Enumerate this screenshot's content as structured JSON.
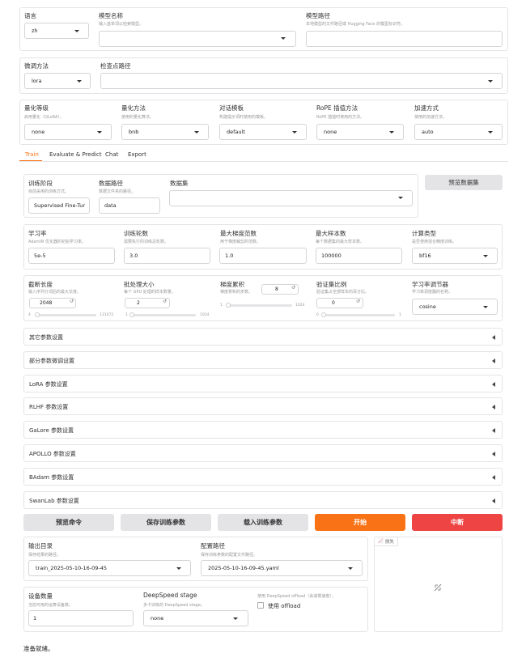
{
  "row1": {
    "lang": {
      "label": "语言",
      "value": "zh"
    },
    "model_name": {
      "label": "模型名称",
      "hint": "输入首单词以检索模型。",
      "value": ""
    },
    "model_path": {
      "label": "模型路径",
      "hint": "本地模型的文件路径或 Hugging Face 的模型标识符。",
      "value": ""
    }
  },
  "row2": {
    "finetune": {
      "label": "微调方法",
      "value": "lora"
    },
    "checkpoint": {
      "label": "检查点路径",
      "value": ""
    }
  },
  "row3": {
    "quant_bit": {
      "label": "量化等级",
      "hint": "启用量化（QLoRA）。",
      "value": "none"
    },
    "quant_method": {
      "label": "量化方法",
      "hint": "使用的量化算法。",
      "value": "bnb"
    },
    "template": {
      "label": "对话模板",
      "hint": "构建提示词时使用的模板。",
      "value": "default"
    },
    "rope": {
      "label": "RoPE 插值方法",
      "hint": "RoPE 插值时使用的方法。",
      "value": "none"
    },
    "booster": {
      "label": "加速方式",
      "hint": "使用的加速方法。",
      "value": "auto"
    }
  },
  "tabs": [
    "Train",
    "Evaluate & Predict",
    "Chat",
    "Export"
  ],
  "stage_row": {
    "stage": {
      "label": "训练阶段",
      "hint": "目前采用的训练方式。",
      "value": "Supervised Fine-Tur"
    },
    "dataset_dir": {
      "label": "数据路径",
      "hint": "数据文件夹的路径。",
      "value": "data"
    },
    "dataset": {
      "label": "数据集",
      "value": ""
    },
    "preview_button": "预览数据集"
  },
  "params1": {
    "lr": {
      "label": "学习率",
      "hint": "AdamW 优化器的初始学习率。",
      "value": "5e-5"
    },
    "epochs": {
      "label": "训练轮数",
      "hint": "需要执行的训练总轮数。",
      "value": "3.0"
    },
    "grad_norm": {
      "label": "最大梯度范数",
      "hint": "用于梯度裁剪的范数。",
      "value": "1.0"
    },
    "max_samples": {
      "label": "最大样本数",
      "hint": "每个数据集的最大样本数。",
      "value": "100000"
    },
    "compute": {
      "label": "计算类型",
      "hint": "是否使用混合精度训练。",
      "value": "bf16"
    }
  },
  "params2": {
    "cutoff": {
      "label": "截断长度",
      "hint": "输入序列分词后的最大长度。",
      "value": "2048",
      "min": "4",
      "max": "131072",
      "level": 0.016
    },
    "batch": {
      "label": "批处理大小",
      "hint": "每个 GPU 处理的样本数量。",
      "value": "2",
      "min": "1",
      "max": "1024",
      "level": 0.001
    },
    "grad_accum": {
      "label": "梯度累积",
      "hint": "梯度累积的步数。",
      "value": "8",
      "min": "1",
      "max": "1024",
      "level": 0.007
    },
    "val_size": {
      "label": "验证集比例",
      "hint": "验证集占全部样本的百分比。",
      "value": "0",
      "min": "0",
      "max": "1",
      "level": 0.0
    },
    "scheduler": {
      "label": "学习率调节器",
      "hint": "学习率调度器的名称。",
      "value": "cosine"
    }
  },
  "accordions": [
    "其它参数设置",
    "部分参数微调设置",
    "LoRA 参数设置",
    "RLHF 参数设置",
    "GaLore 参数设置",
    "APOLLO 参数设置",
    "BAdam 参数设置",
    "SwanLab 参数设置"
  ],
  "actions": {
    "preview_cmd": "预览命令",
    "save_args": "保存训练参数",
    "load_args": "载入训练参数",
    "start": "开始",
    "abort": "中断"
  },
  "output": {
    "output_dir": {
      "label": "输出目录",
      "hint": "保存结果的路径。",
      "value": "train_2025-05-10-16-09-45"
    },
    "config_path": {
      "label": "配置路径",
      "hint": "保存训练参数的配置文件路径。",
      "value": "2025-05-10-16-09-45.yaml"
    },
    "devices": {
      "label": "设备数量",
      "hint": "当前可用的运算设备数。",
      "value": "1"
    },
    "ds_stage": {
      "label": "DeepSpeed stage",
      "hint": "多卡训练的 DeepSpeed stage。",
      "value": "none"
    },
    "ds_offload": {
      "hint": "使用 DeepSpeed offload（会减慢速度）。",
      "label": "使用 offload"
    },
    "loss_label": "损失"
  },
  "status": "准备就绪。",
  "colors": {
    "accent": "#f97316",
    "abort": "#ef4444",
    "gray_button": "#e4e4e7"
  }
}
